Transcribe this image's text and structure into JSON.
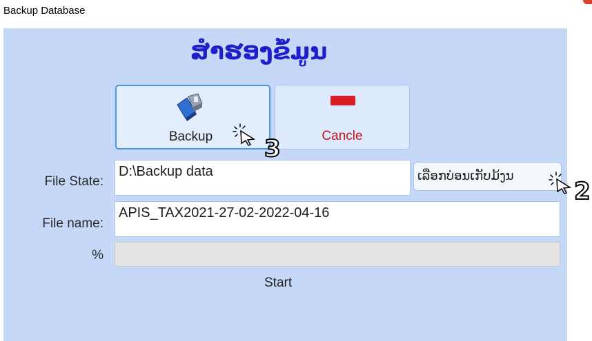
{
  "window": {
    "title": "Backup Database"
  },
  "heading": "ສຳຮອງຂໍ້ມູນ",
  "toolbar": {
    "backup_label": "Backup",
    "cancel_label": "Cancle"
  },
  "form": {
    "file_state_label": "File State:",
    "file_state_value": "D:\\Backup  data",
    "choose_folder_label": "ເລືອກບ່ອນເກັບມ້ງນ",
    "file_name_label": "File name:",
    "file_name_value": "APIS_TAX2021-27-02-2022-04-16",
    "progress_label": "%",
    "progress_value": 0
  },
  "status": {
    "text": "Start"
  },
  "annotations": {
    "step_2": "2",
    "step_3": "3"
  },
  "colors": {
    "panel_bg": "#c5d8f8",
    "heading": "#1f1fc8",
    "cancel_text": "#c4141f",
    "cancel_icon": "#dc1c22"
  }
}
